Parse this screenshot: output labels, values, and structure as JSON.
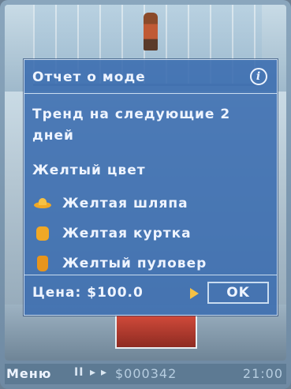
{
  "dialog": {
    "title": "Отчет о моде",
    "info_icon_glyph": "i",
    "trend_text": "Тренд на следующие 2 дней",
    "color_heading": "Желтый цвет",
    "items": [
      {
        "label": "Желтая шляпа",
        "icon": "hat-icon"
      },
      {
        "label": "Желтая куртка",
        "icon": "jacket-icon"
      },
      {
        "label": "Желтый пуловер",
        "icon": "sweater-icon"
      }
    ],
    "price_label": "Цена: $100.0",
    "ok_label": "OK",
    "colors": {
      "panel": "#3a6caf",
      "border": "#c9dcf0",
      "accent": "#f6c144"
    }
  },
  "statusbar": {
    "menu_label": "Меню",
    "pause_glyph": "II",
    "play_glyph": "▸",
    "fast_forward_glyph": "▸",
    "money": "$000342",
    "clock": "21:00"
  }
}
